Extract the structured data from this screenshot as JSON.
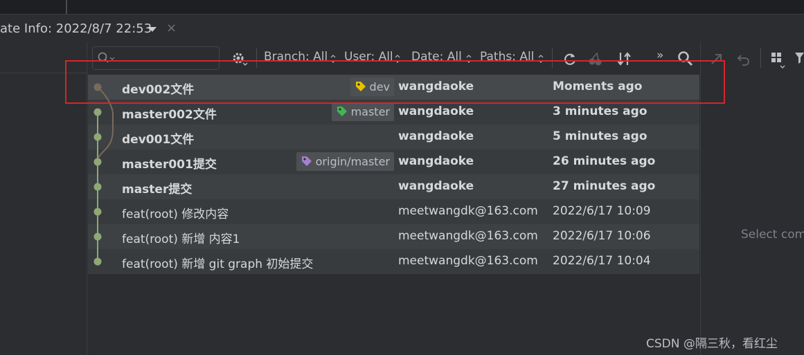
{
  "window": {
    "tab_title": "ate Info: 2022/8/7 22:53",
    "close_glyph": "×"
  },
  "toolbar": {
    "branch": "Branch: All",
    "user": "User: All",
    "date": "Date: All",
    "paths": "Paths: All",
    "more_glyph": "»"
  },
  "commits": [
    {
      "message": "dev002文件",
      "tag": "dev",
      "tag_color": "#e5c300",
      "author": "wangdaoke",
      "date": "Moments ago",
      "bold": true
    },
    {
      "message": "master002文件",
      "tag": "master",
      "tag_color": "#3fb950",
      "author": "wangdaoke",
      "date": "3 minutes ago",
      "bold": true
    },
    {
      "message": "dev001文件",
      "tag": "",
      "author": "wangdaoke",
      "date": "5 minutes ago",
      "bold": true
    },
    {
      "message": "master001提交",
      "tag": "origin/master",
      "tag_color": "#a77fd1",
      "author": "wangdaoke",
      "date": "26 minutes ago",
      "bold": true
    },
    {
      "message": "master提交",
      "tag": "",
      "author": "wangdaoke",
      "date": "27 minutes ago",
      "bold": true
    },
    {
      "message": "feat(root) 修改内容",
      "tag": "",
      "author": "meetwangdk@163.com",
      "date": "2022/6/17 10:09",
      "bold": false
    },
    {
      "message": "feat(root) 新增 内容1",
      "tag": "",
      "author": "meetwangdk@163.com",
      "date": "2022/6/17 10:06",
      "bold": false
    },
    {
      "message": "feat(root) 新增 git graph 初始提交",
      "tag": "",
      "author": "meetwangdk@163.com",
      "date": "2022/6/17 10:04",
      "bold": false
    }
  ],
  "details_panel": {
    "placeholder": "Select com"
  },
  "watermark": "CSDN @隔三秋，看红尘",
  "colors": {
    "graph_master": "#8fa876",
    "graph_dev": "#7a6a5c",
    "highlight": "#d9252a"
  }
}
